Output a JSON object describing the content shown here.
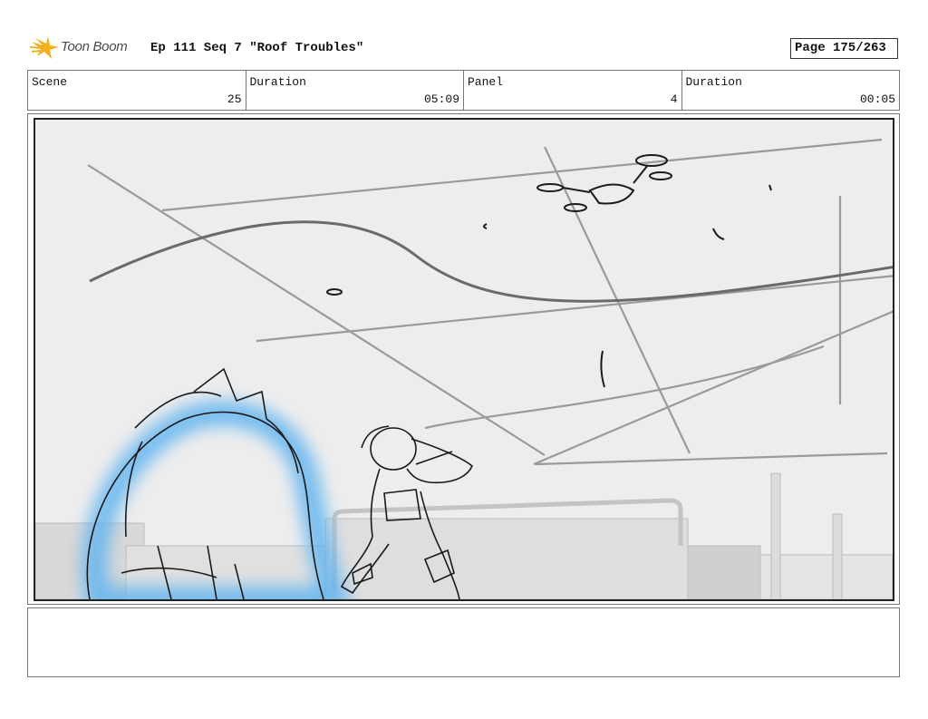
{
  "header": {
    "logo_text": "Toon Boom",
    "episode_title": "Ep 111 Seq 7 \"Roof Troubles\"",
    "page": "Page 175/263"
  },
  "info": {
    "scene_label": "Scene",
    "scene_value": "25",
    "scene_duration_label": "Duration",
    "scene_duration_value": "05:09",
    "panel_label": "Panel",
    "panel_value": "4",
    "panel_duration_label": "Duration",
    "panel_duration_value": "00:05"
  },
  "colors": {
    "logo_star": "#f2b01e",
    "glow": "#5fb4f0",
    "sketch": "#1a1a1a"
  },
  "notes": {
    "text": ""
  }
}
